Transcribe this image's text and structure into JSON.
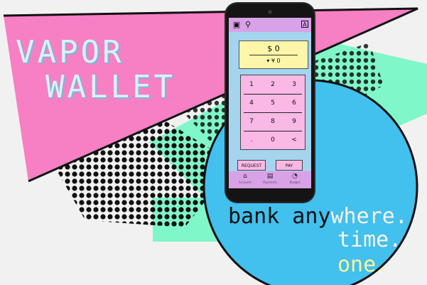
{
  "hero": {
    "title_line1": "VAPOR",
    "title_line2": "WALLET"
  },
  "tagline": {
    "line1_a": "bank any",
    "line1_b": "where.",
    "line2": "time.",
    "line3": "one."
  },
  "app": {
    "toolbar": {
      "qr_icon": "qr-scan-icon",
      "search_icon": "search-icon",
      "account_icon": "A"
    },
    "amount": {
      "primary": "$ 0",
      "secondary": "▾ ¥ 0"
    },
    "keypad": {
      "keys": [
        "1",
        "2",
        "3",
        "4",
        "5",
        "6",
        "7",
        "8",
        "9",
        ".",
        "0",
        "<"
      ]
    },
    "actions": {
      "request": "REQUEST",
      "pay": "PAY"
    },
    "nav": {
      "items": [
        {
          "icon": "bank-icon",
          "label": "Accounts"
        },
        {
          "icon": "payments-icon",
          "label": "Payments"
        },
        {
          "icon": "budget-icon",
          "label": "Budget"
        }
      ]
    }
  },
  "colors": {
    "pink": "#f77fc4",
    "mint": "#7ff7c9",
    "sky": "#42c0ee",
    "screen_bg": "#a5d4ee",
    "bars": "#d9a1e7",
    "display": "#fdf5a8",
    "keypad": "#f9b8e6"
  }
}
